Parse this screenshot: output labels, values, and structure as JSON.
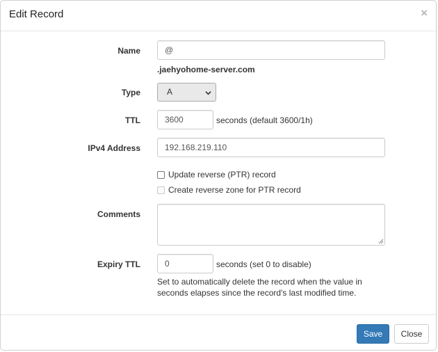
{
  "dialog": {
    "title": "Edit Record",
    "close_glyph": "×",
    "close_icon": "close-icon"
  },
  "form": {
    "name": {
      "label": "Name",
      "value": "@",
      "zone_suffix": ".jaehyohome-server.com"
    },
    "type": {
      "label": "Type",
      "selected": "A"
    },
    "ttl": {
      "label": "TTL",
      "value": "3600",
      "hint": "seconds (default 3600/1h)"
    },
    "ipv4": {
      "label": "IPv4 Address",
      "value": "192.168.219.110"
    },
    "update_ptr": {
      "label": "Update reverse (PTR) record",
      "checked": false,
      "disabled": false
    },
    "create_reverse_zone": {
      "label": "Create reverse zone for PTR record",
      "checked": false,
      "disabled": true
    },
    "comments": {
      "label": "Comments",
      "value": ""
    },
    "expiry_ttl": {
      "label": "Expiry TTL",
      "value": "0",
      "hint": "seconds (set 0 to disable)",
      "help_text": "Set to automatically delete the record when the value in seconds elapses since the record's last modified time."
    }
  },
  "footer": {
    "save_label": "Save",
    "close_label": "Close"
  },
  "colors": {
    "primary": "#337ab7",
    "border": "#cccccc",
    "select_bg": "#e9e9e9"
  }
}
